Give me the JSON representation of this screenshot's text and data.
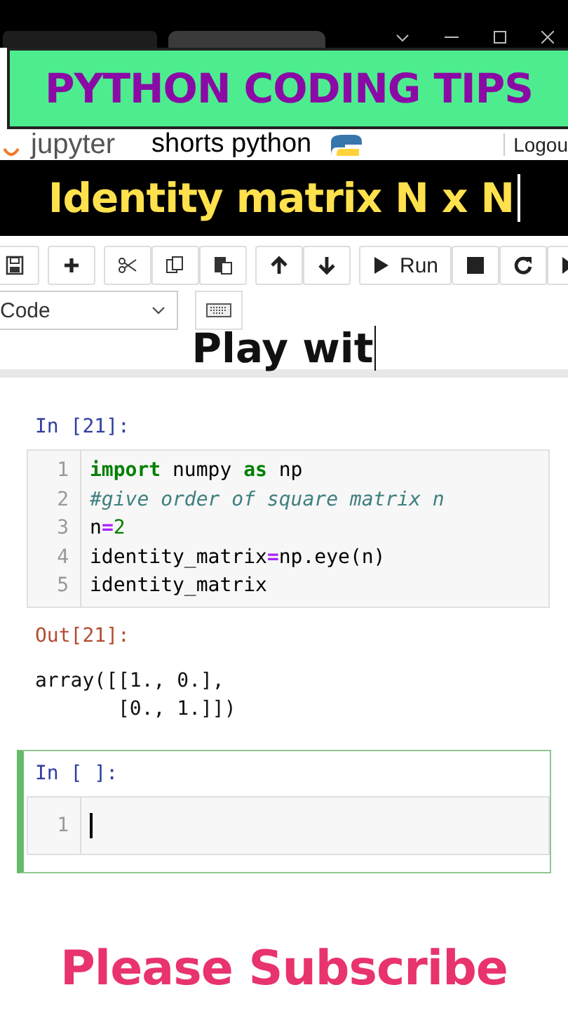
{
  "top_banner": {
    "text": "PYTHON CODING TIPS"
  },
  "header": {
    "logo_text": "jupyter",
    "notebook_name": "shorts python",
    "logout": "Logou"
  },
  "title_banner": {
    "text": "Identity matrix N x N"
  },
  "toolbar": {
    "groups": [
      [
        {
          "kind": "save"
        }
      ],
      [
        {
          "kind": "plus"
        }
      ],
      [
        {
          "kind": "cut"
        },
        {
          "kind": "copy"
        },
        {
          "kind": "paste"
        }
      ],
      [
        {
          "kind": "up"
        },
        {
          "kind": "down"
        }
      ],
      [
        {
          "kind": "run",
          "label": "Run"
        },
        {
          "kind": "stop"
        },
        {
          "kind": "restart"
        },
        {
          "kind": "forward"
        }
      ]
    ],
    "cell_type": "Code"
  },
  "overlay_caption": {
    "text": "Play wit"
  },
  "cells": [
    {
      "prompt": "In [21]:",
      "selected": false,
      "lines": [
        [
          {
            "kind": "keyword",
            "text": "import"
          },
          {
            "kind": "plain",
            "text": " numpy "
          },
          {
            "kind": "keyword",
            "text": "as"
          },
          {
            "kind": "plain",
            "text": " np"
          }
        ],
        [
          {
            "kind": "comment",
            "text": "#give order of square matrix n"
          }
        ],
        [
          {
            "kind": "plain",
            "text": "n"
          },
          {
            "kind": "operator",
            "text": "="
          },
          {
            "kind": "number",
            "text": "2"
          }
        ],
        [
          {
            "kind": "plain",
            "text": "identity_matrix"
          },
          {
            "kind": "operator",
            "text": "="
          },
          {
            "kind": "plain",
            "text": "np.eye(n)"
          }
        ],
        [
          {
            "kind": "plain",
            "text": "identity_matrix"
          }
        ]
      ],
      "line_numbers": [
        "1",
        "2",
        "3",
        "4",
        "5"
      ],
      "output": {
        "prompt": "Out[21]:",
        "text": "array([[1., 0.],\n       [0., 1.]])"
      }
    },
    {
      "prompt": "In [ ]:",
      "selected": true,
      "line_numbers": [
        "1"
      ]
    }
  ],
  "bottom_banner": {
    "text": "Please Subscribe"
  }
}
